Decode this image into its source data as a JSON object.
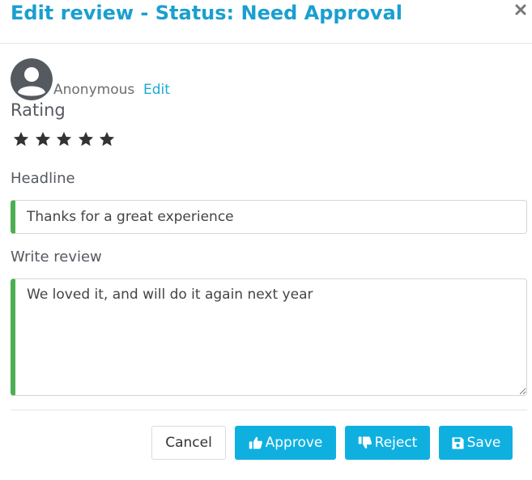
{
  "header": {
    "title": "Edit review - Status: Need Approval",
    "close_icon": "close-icon"
  },
  "author": {
    "avatar_icon": "user-avatar-icon",
    "name": "Anonymous",
    "edit_label": "Edit"
  },
  "rating": {
    "label": "Rating",
    "value": 5,
    "max": 5,
    "star_color": "#333333"
  },
  "headline": {
    "label": "Headline",
    "value": "Thanks for a great experience"
  },
  "review": {
    "label": "Write review",
    "value": "We loved it, and will do it again next year"
  },
  "footer": {
    "cancel_label": "Cancel",
    "approve_label": "Approve",
    "approve_icon": "thumbs-up-icon",
    "reject_label": "Reject",
    "reject_icon": "thumbs-down-icon",
    "save_label": "Save",
    "save_icon": "floppy-disk-icon"
  },
  "colors": {
    "title": "#1a9fd0",
    "link": "#1ba9d5",
    "primary_button": "#0fb0e0",
    "field_accent": "#4caf50"
  }
}
